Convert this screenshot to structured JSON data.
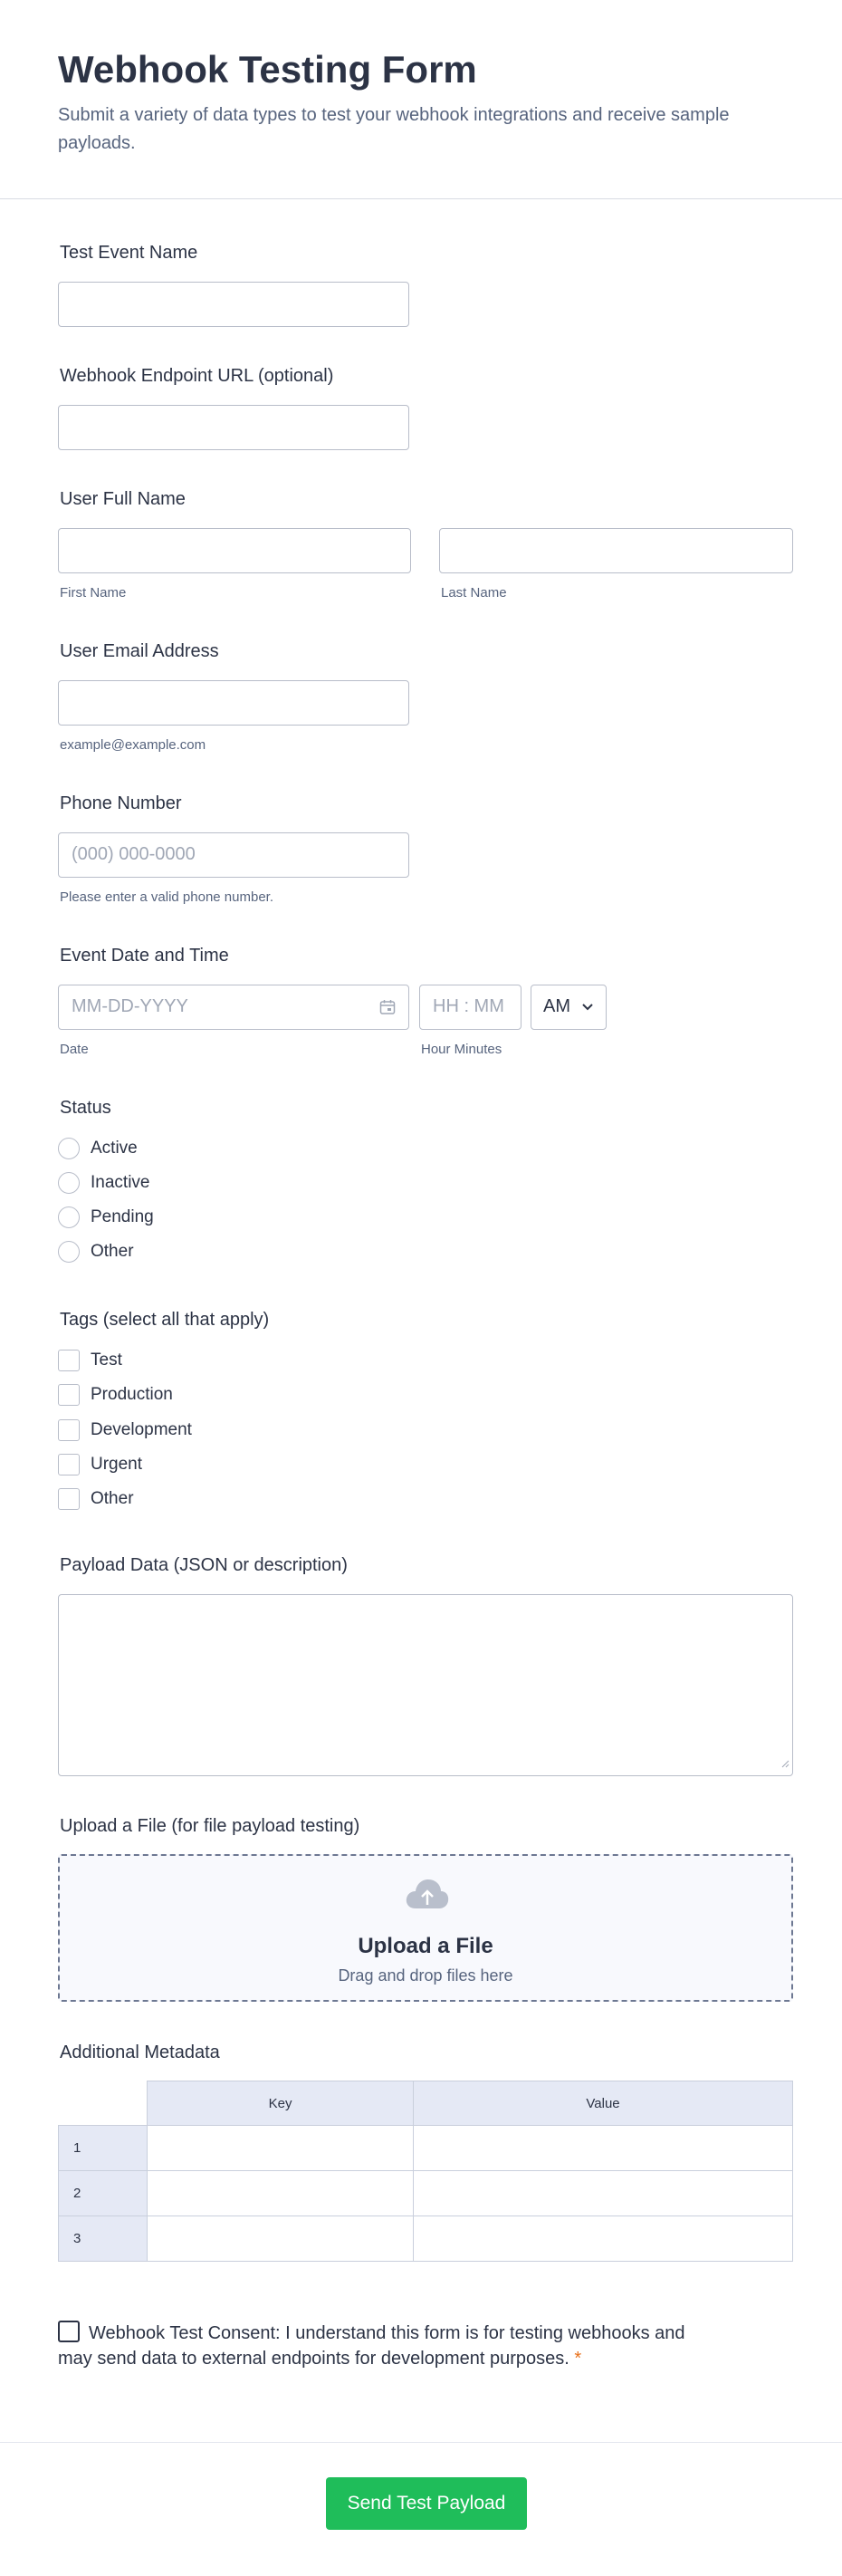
{
  "header": {
    "title": "Webhook Testing Form",
    "subtitle": "Submit a variety of data types to test your webhook integrations and receive sample payloads."
  },
  "fields": {
    "event_name": {
      "label": "Test Event Name",
      "value": ""
    },
    "endpoint_url": {
      "label": "Webhook Endpoint URL (optional)",
      "value": ""
    },
    "full_name": {
      "label": "User Full Name",
      "first_sub": "First Name",
      "last_sub": "Last Name"
    },
    "email": {
      "label": "User Email Address",
      "sub": "example@example.com"
    },
    "phone": {
      "label": "Phone Number",
      "placeholder": "(000) 000-0000",
      "sub": "Please enter a valid phone number."
    },
    "datetime": {
      "label": "Event Date and Time",
      "date_placeholder": "MM-DD-YYYY",
      "time_placeholder": "HH : MM",
      "ampm": "AM",
      "date_sub": "Date",
      "time_sub": "Hour Minutes"
    },
    "status": {
      "label": "Status",
      "options": [
        "Active",
        "Inactive",
        "Pending",
        "Other"
      ]
    },
    "tags": {
      "label": "Tags (select all that apply)",
      "options": [
        "Test",
        "Production",
        "Development",
        "Urgent",
        "Other"
      ]
    },
    "payload": {
      "label": "Payload Data (JSON or description)"
    },
    "upload": {
      "label": "Upload a File (for file payload testing)",
      "title": "Upload a File",
      "sub": "Drag and drop files here"
    },
    "metadata": {
      "label": "Additional Metadata",
      "columns": [
        "Key",
        "Value"
      ],
      "rows": [
        "1",
        "2",
        "3"
      ]
    },
    "consent": {
      "text": "Webhook Test Consent: I understand this form is for testing webhooks and may send data to external endpoints for development purposes.",
      "required_mark": "*"
    }
  },
  "footer": {
    "submit_label": "Send Test Payload"
  },
  "colors": {
    "submit": "#1fbd5a",
    "required": "#e8701a",
    "table_header": "#e5e9f5"
  },
  "icons": [
    "calendar-icon",
    "chevron-down-icon",
    "cloud-upload-icon",
    "resize-handle-icon"
  ]
}
